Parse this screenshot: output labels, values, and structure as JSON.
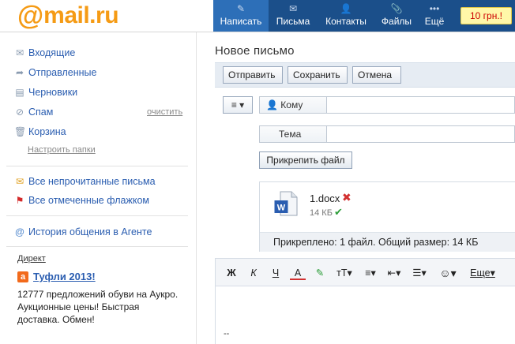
{
  "brand": {
    "at": "@",
    "name": "mail.ru"
  },
  "nav": [
    {
      "icon": "pencil-icon",
      "glyph": "✎",
      "label": "Написать"
    },
    {
      "icon": "envelope-icon",
      "glyph": "✉",
      "label": "Письма"
    },
    {
      "icon": "people-icon",
      "glyph": "👤",
      "label": "Контакты"
    },
    {
      "icon": "paperclip-icon",
      "glyph": "📎",
      "label": "Файлы"
    },
    {
      "icon": "dots-icon",
      "glyph": "•••",
      "label": "Ещё"
    }
  ],
  "balance": "10 грн.!",
  "sidebar": {
    "folders": [
      {
        "icon": "inbox-icon",
        "glyph": "✉",
        "label": "Входящие"
      },
      {
        "icon": "sent-icon",
        "glyph": "➦",
        "label": "Отправленные"
      },
      {
        "icon": "drafts-icon",
        "glyph": "▤",
        "label": "Черновики"
      },
      {
        "icon": "spam-icon",
        "glyph": "⊘",
        "label": "Спам"
      },
      {
        "icon": "trash-icon",
        "glyph": "🗑",
        "label": "Корзина"
      }
    ],
    "clean_link": "очистить",
    "setup_link": "Настроить папки",
    "filters": [
      {
        "icon": "unread-icon",
        "glyph": "✉",
        "label": "Все непрочитанные письма"
      },
      {
        "icon": "flag-icon",
        "glyph": "⚑",
        "label": "Все отмеченные флажком"
      }
    ],
    "agent": {
      "icon": "agent-icon",
      "glyph": "@",
      "label": "История общения в Агенте"
    },
    "ad": {
      "label": "Директ",
      "logo": "a",
      "title": "Туфли 2013!",
      "text": "12777 предложений обуви на Аукро. Аукционные цены! Быстрая доставка. Обмен!"
    }
  },
  "compose": {
    "title": "Новое письмо",
    "buttons": {
      "send": "Отправить",
      "save": "Сохранить",
      "cancel": "Отмена"
    },
    "menu_glyph": "≡ ▾",
    "to_label": "Кому",
    "subject_label": "Тема",
    "attach_button": "Прикрепить файл",
    "attachment": {
      "name": "1.docx",
      "size": "14 КБ",
      "remove_glyph": "✖",
      "ok_glyph": "✔"
    },
    "attach_summary": "Прикреплено: 1 файл. Общий размер: 14 КБ",
    "format": [
      {
        "name": "bold-button",
        "label": "Ж"
      },
      {
        "name": "italic-button",
        "label": "К"
      },
      {
        "name": "underline-button",
        "label": "Ч"
      },
      {
        "name": "text-color-button",
        "label": "А"
      },
      {
        "name": "highlight-button",
        "label": "✎"
      },
      {
        "name": "font-size-button",
        "label": "тТ▾"
      },
      {
        "name": "align-button",
        "label": "≡▾"
      },
      {
        "name": "indent-button",
        "label": "⇤▾"
      },
      {
        "name": "list-button",
        "label": "☰▾"
      },
      {
        "name": "smiley-button",
        "label": "☺▾"
      },
      {
        "name": "more-button",
        "label": "Еще▾"
      }
    ],
    "signature": "--"
  }
}
